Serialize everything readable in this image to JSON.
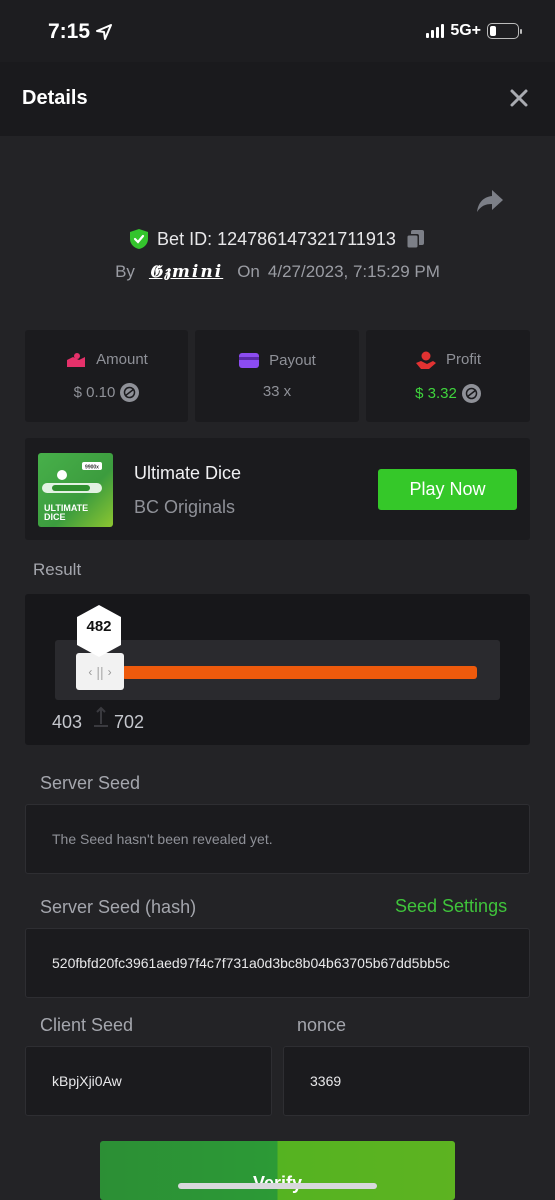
{
  "status_bar": {
    "time": "7:15",
    "network": "5G+"
  },
  "header": {
    "title": "Details"
  },
  "bet": {
    "bet_id": "Bet ID: 124786147321711913",
    "by_label": "By",
    "user": "𝕲𝖟mini",
    "on_label": "On",
    "datetime": "4/27/2023, 7:15:29 PM"
  },
  "stats": [
    {
      "label": "Amount",
      "value": "$ 0.10",
      "icon": "amount-icon",
      "color": "#e5316a"
    },
    {
      "label": "Payout",
      "value": "33 x",
      "icon": "payout-card-icon",
      "color": "#8c4cf1"
    },
    {
      "label": "Profit",
      "value": "$ 3.32",
      "icon": "profit-icon",
      "color": "#e13232"
    }
  ],
  "game": {
    "name": "Ultimate Dice",
    "provider": "BC Originals",
    "play_label": "Play Now",
    "thumb_text": "ULTIMATE DICE",
    "thumb_badge": "9900x"
  },
  "result": {
    "label": "Result",
    "value": "482",
    "range_low": "403",
    "range_high": "702",
    "scale_min": 0,
    "scale_max": 10000,
    "bar_color": "#ee5a0c"
  },
  "server_seed": {
    "label": "Server Seed",
    "placeholder": "The Seed hasn't been revealed yet."
  },
  "server_seed_hash": {
    "label": "Server Seed (hash)",
    "link": "Seed Settings",
    "value": "520fbfd20fc3961aed97f4c7f731a0d3bc8b04b63705b67dd5bb5c"
  },
  "client_seed": {
    "label": "Client Seed",
    "value": "kBpjXji0Aw"
  },
  "nonce": {
    "label": "nonce",
    "value": "3369"
  },
  "verify_label": "Verify",
  "colors": {
    "accent_green": "#3fc43b",
    "play_green": "#35c829",
    "orange": "#ee5a0c"
  }
}
